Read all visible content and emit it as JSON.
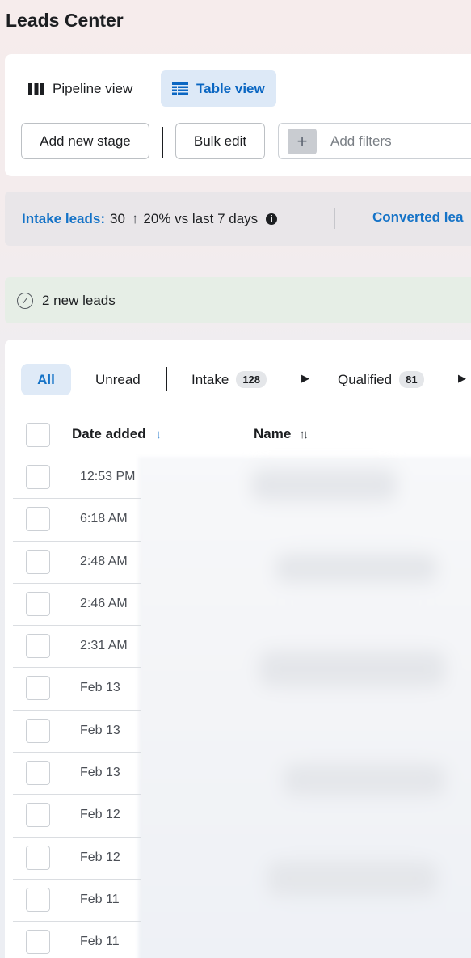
{
  "page": {
    "title": "Leads Center"
  },
  "views": {
    "pipeline_label": "Pipeline view",
    "table_label": "Table view"
  },
  "actions": {
    "add_stage": "Add new stage",
    "bulk_edit": "Bulk edit",
    "filter_placeholder": "Add filters"
  },
  "stats": {
    "intake_label": "Intake leads:",
    "intake_value": "30",
    "intake_change": "20% vs last 7 days",
    "converted_label": "Converted lea"
  },
  "banner": {
    "text": "2 new leads"
  },
  "tabs": {
    "all": "All",
    "unread": "Unread",
    "intake": "Intake",
    "intake_count": "128",
    "qualified": "Qualified",
    "qualified_count": "81"
  },
  "table": {
    "columns": [
      "Date added",
      "Name"
    ],
    "rows": [
      {
        "date": "12:53 PM"
      },
      {
        "date": "6:18 AM"
      },
      {
        "date": "2:48 AM"
      },
      {
        "date": "2:46 AM"
      },
      {
        "date": "2:31 AM"
      },
      {
        "date": "Feb 13"
      },
      {
        "date": "Feb 13"
      },
      {
        "date": "Feb 13"
      },
      {
        "date": "Feb 12"
      },
      {
        "date": "Feb 12"
      },
      {
        "date": "Feb 11"
      },
      {
        "date": "Feb 11"
      }
    ]
  },
  "colors": {
    "accent": "#1573c7",
    "active_tab_bg": "#dfeaf7",
    "banner_bg": "#e6eee6"
  }
}
